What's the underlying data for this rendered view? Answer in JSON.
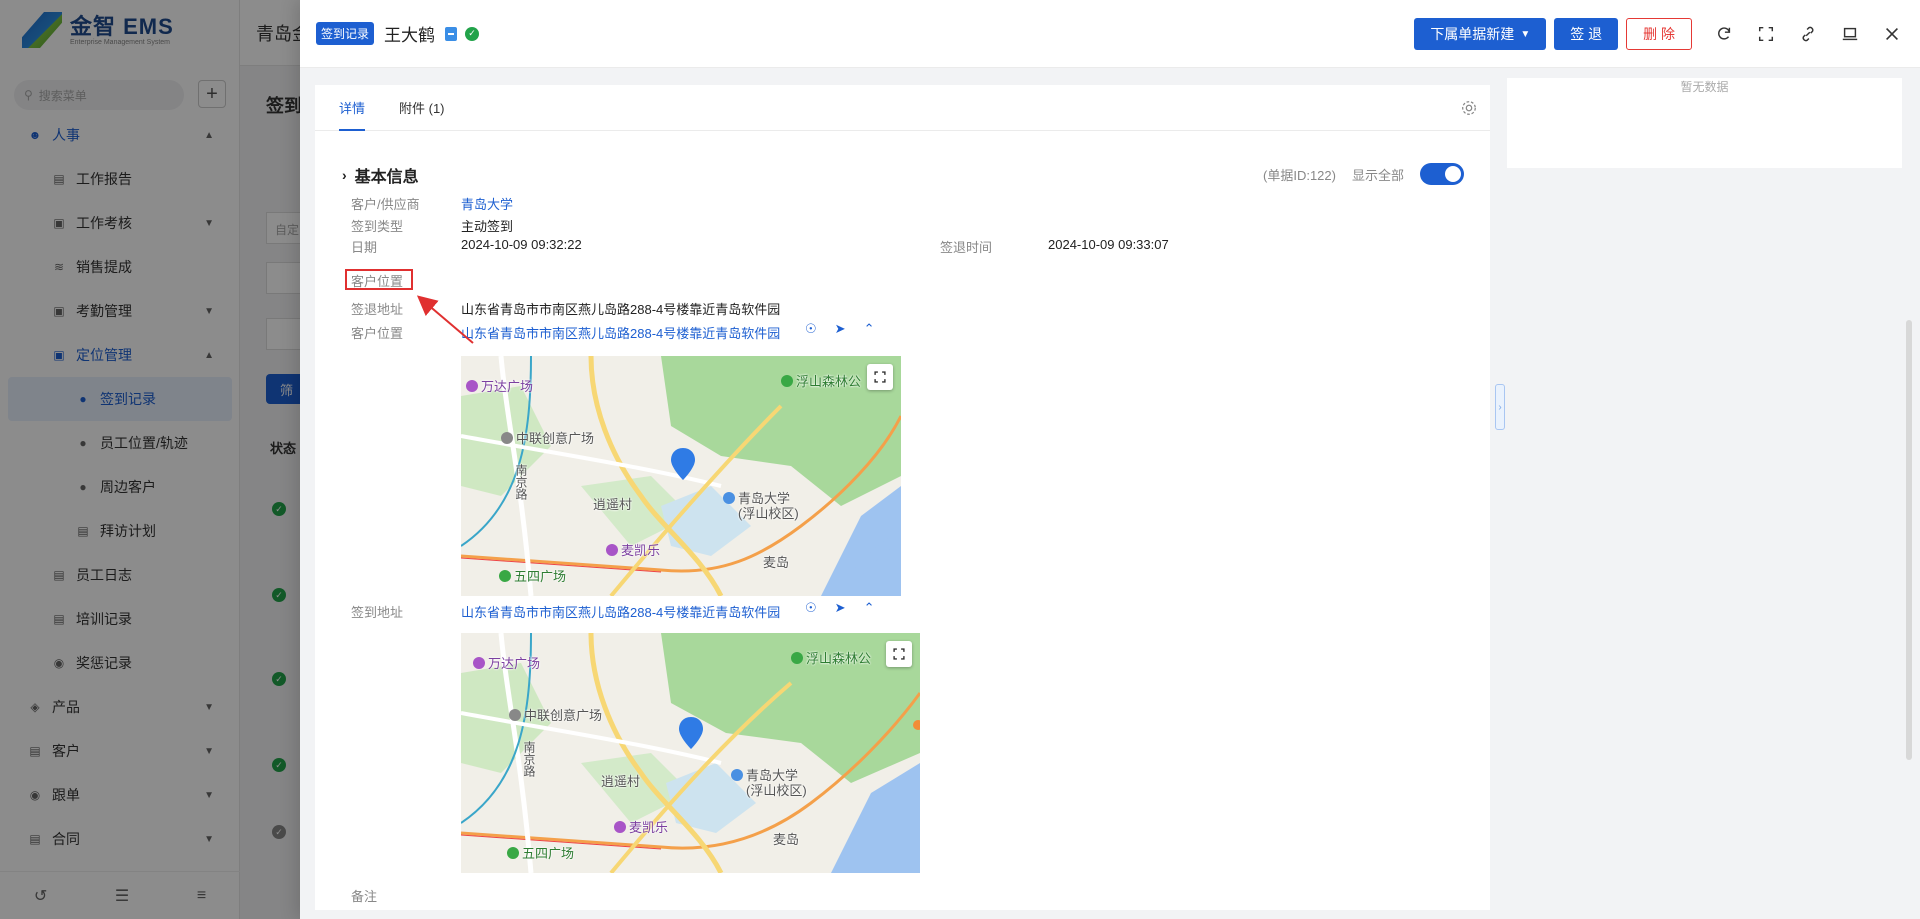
{
  "app": {
    "logo_title": "金智 EMS",
    "logo_subtitle": "Enterprise Management System",
    "bg_company": "青岛金",
    "bg_page_title": "签到",
    "bg_input_placeholder": "自定",
    "bg_filter_label": "筛",
    "bg_status_col": "状态"
  },
  "sidebar": {
    "search_placeholder": "搜索菜单",
    "items": [
      {
        "label": "人事",
        "icon": "person-icon",
        "level": 0,
        "state": "group-open"
      },
      {
        "label": "工作报告",
        "icon": "report-icon",
        "level": 1
      },
      {
        "label": "工作考核",
        "icon": "assess-icon",
        "level": 1,
        "chevron": "down"
      },
      {
        "label": "销售提成",
        "icon": "commission-icon",
        "level": 1
      },
      {
        "label": "考勤管理",
        "icon": "attendance-icon",
        "level": 1,
        "chevron": "down"
      },
      {
        "label": "定位管理",
        "icon": "location-icon",
        "level": 1,
        "state": "group-open"
      },
      {
        "label": "签到记录",
        "icon": "checkin-icon",
        "level": 2,
        "state": "active"
      },
      {
        "label": "员工位置/轨迹",
        "icon": "track-icon",
        "level": 2
      },
      {
        "label": "周边客户",
        "icon": "nearby-icon",
        "level": 2
      },
      {
        "label": "拜访计划",
        "icon": "plan-icon",
        "level": 2
      },
      {
        "label": "员工日志",
        "icon": "log-icon",
        "level": 1
      },
      {
        "label": "培训记录",
        "icon": "training-icon",
        "level": 1
      },
      {
        "label": "奖惩记录",
        "icon": "reward-icon",
        "level": 1
      },
      {
        "label": "产品",
        "icon": "product-icon",
        "level": 0,
        "chevron": "down"
      },
      {
        "label": "客户",
        "icon": "customer-icon",
        "level": 0,
        "chevron": "down"
      },
      {
        "label": "跟单",
        "icon": "followup-icon",
        "level": 0,
        "chevron": "down"
      },
      {
        "label": "合同",
        "icon": "contract-icon",
        "level": 0,
        "chevron": "down"
      }
    ]
  },
  "drawer": {
    "tag": "签到记录",
    "title": "王大鹤",
    "actions": {
      "new_sub_doc": "下属单据新建",
      "checkout": "签 退",
      "delete": "删 除"
    },
    "tabs": [
      "详情",
      "附件 (1)"
    ],
    "section_title": "基本信息",
    "doc_id": "(单据ID:122)",
    "show_all": "显示全部",
    "fields": {
      "customer_label": "客户/供应商",
      "customer_value": "青岛大学",
      "checkin_type_label": "签到类型",
      "checkin_type_value": "主动签到",
      "date_label": "日期",
      "date_value": "2024-10-09 09:32:22",
      "checkout_time_label": "签退时间",
      "checkout_time_value": "2024-10-09 09:33:07",
      "customer_location_label_boxed": "客户位置",
      "checkout_address_label": "签退地址",
      "checkout_address_value": "山东省青岛市市南区燕儿岛路288-4号楼靠近青岛软件园",
      "customer_location_label": "客户位置",
      "customer_location_value": "山东省青岛市市南区燕儿岛路288-4号楼靠近青岛软件园",
      "checkin_address_label": "签到地址",
      "checkin_address_value": "山东省青岛市市南区燕儿岛路288-4号楼靠近青岛软件园",
      "remark_label": "备注"
    },
    "map": {
      "labels": {
        "wanda": "万达广场",
        "fushan": "浮山森林公",
        "zhonglian": "中联创意广场",
        "nanjing_road": "南京路",
        "xiaoyao": "逍遥村",
        "qdu": "青岛大学",
        "qdu_campus": "(浮山校区)",
        "mcd": "麦凯乐",
        "wusi": "五四广场",
        "maidao": "麦岛"
      }
    },
    "side_panel": {
      "no_data": "暂无数据"
    }
  },
  "colors": {
    "primary": "#1d5fd1",
    "danger": "#e53935",
    "success": "#22a34a",
    "highlight_box": "#e03030"
  }
}
